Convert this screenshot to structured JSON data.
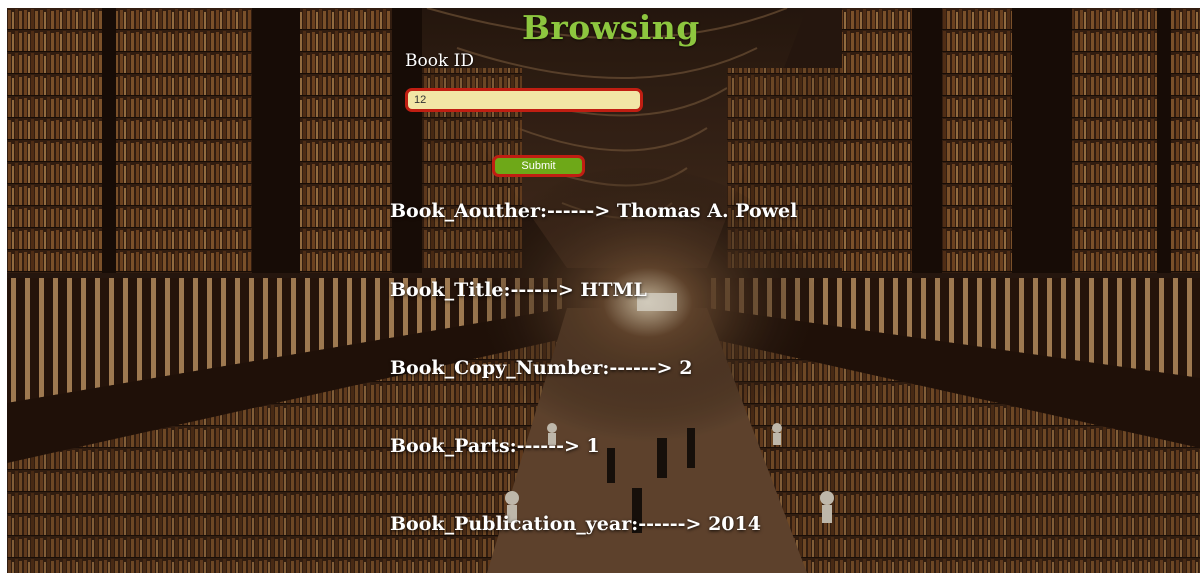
{
  "page": {
    "title": "Browsing",
    "book_id_label": "Book ID",
    "book_id_value": "12",
    "submit_label": "Submit"
  },
  "results": [
    {
      "label": "Book_Aouther:------>",
      "value": "Thomas A. Powel"
    },
    {
      "label": "Book_Title:------>",
      "value": "HTML"
    },
    {
      "label": "Book_Copy_Number:------>",
      "value": "2"
    },
    {
      "label": "Book_Parts:------>",
      "value": "1"
    },
    {
      "label": "Book_Publication_year:------>",
      "value": "2014"
    }
  ],
  "colors": {
    "title": "#8dc63f",
    "input_bg": "#f2e6a6",
    "border_red": "#c01e12",
    "button_green": "#6ea818"
  }
}
